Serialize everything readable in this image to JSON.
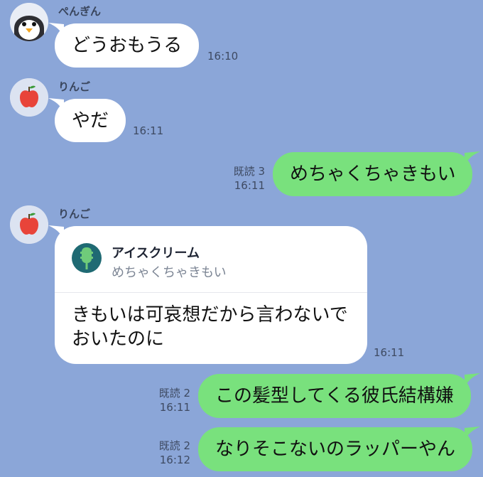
{
  "colors": {
    "background": "#8BA6D8",
    "incoming_bubble": "#FFFFFF",
    "outgoing_bubble": "#79E17D",
    "reply_thumb": "#1F6A73"
  },
  "messages": [
    {
      "sender": "ぺんぎん",
      "avatar_icon": "penguin-icon",
      "text": "どうおもうる",
      "time": "16:10"
    },
    {
      "sender": "りんご",
      "avatar_icon": "apple-icon",
      "text": "やだ",
      "time": "16:11"
    },
    {
      "text": "めちゃくちゃきもい",
      "read": "既読 3",
      "time": "16:11"
    },
    {
      "sender": "りんご",
      "avatar_icon": "apple-icon",
      "reply_to": {
        "name": "アイスクリーム",
        "thumb_icon": "ice-cream-icon",
        "text": "めちゃくちゃきもい"
      },
      "text": "きもいは可哀想だから言わないで\nおいたのに",
      "time": "16:11"
    },
    {
      "text": "この髪型してくる彼氏結構嫌",
      "read": "既読 2",
      "time": "16:11"
    },
    {
      "text": "なりそこないのラッパーやん",
      "read": "既読 2",
      "time": "16:12"
    }
  ]
}
